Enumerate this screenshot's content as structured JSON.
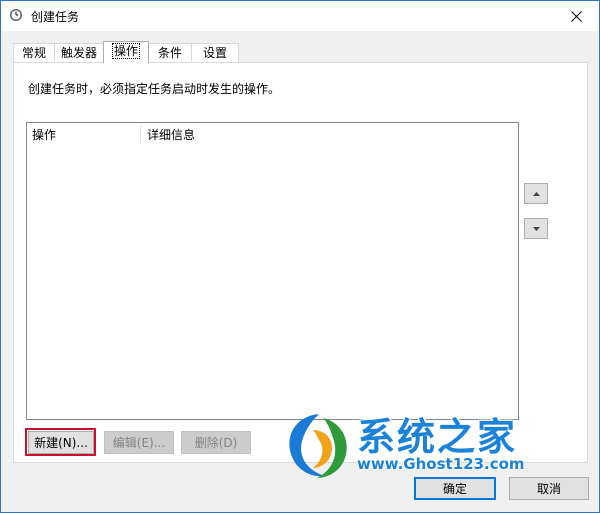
{
  "window": {
    "title": "创建任务",
    "close_glyph": "✕"
  },
  "tabs": [
    {
      "label": "常规",
      "active": false
    },
    {
      "label": "触发器",
      "active": false
    },
    {
      "label": "操作",
      "active": true
    },
    {
      "label": "条件",
      "active": false
    },
    {
      "label": "设置",
      "active": false
    }
  ],
  "actions_panel": {
    "description": "创建任务时，必须指定任务启动时发生的操作。",
    "columns": [
      "操作",
      "详细信息"
    ],
    "rows": [],
    "buttons": {
      "new": "新建(N)...",
      "edit": "编辑(E)...",
      "delete": "删除(D)"
    }
  },
  "dialog_buttons": {
    "ok": "确定",
    "cancel": "取消"
  },
  "watermark": {
    "title": "系统之家",
    "url": "www.Ghost123.com"
  },
  "colors": {
    "accent": "#0078d7",
    "highlight_box": "#c8102e",
    "watermark_blue": "#1a82d8"
  }
}
